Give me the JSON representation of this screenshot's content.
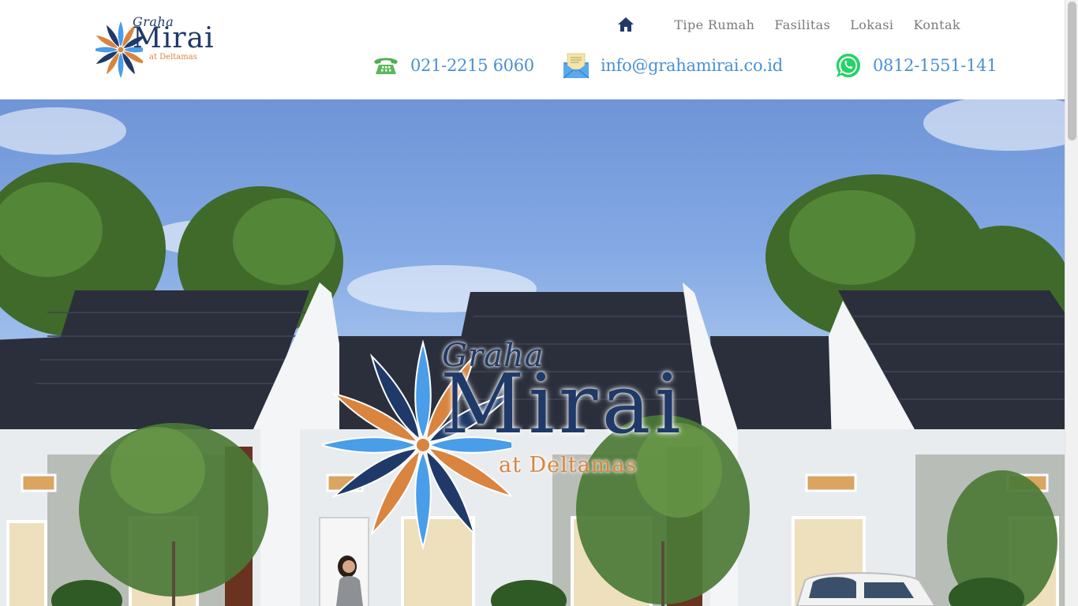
{
  "brand": {
    "graha": "Graha",
    "mirai": "Mirai",
    "deltamas": "at Deltamas",
    "colors": {
      "navy": "#1f3a68",
      "orange": "#d9843f",
      "blue": "#4a9de8"
    }
  },
  "nav": {
    "home_icon": "home-icon",
    "items": [
      {
        "label": "Tipe Rumah"
      },
      {
        "label": "Fasilitas"
      },
      {
        "label": "Lokasi"
      },
      {
        "label": "Kontak"
      }
    ]
  },
  "contact": {
    "phone": {
      "icon": "telephone-icon",
      "text": "021-2215 6060"
    },
    "email": {
      "icon": "envelope-icon",
      "text": "info@grahamirai.co.id"
    },
    "whatsapp": {
      "icon": "whatsapp-icon",
      "text": "0812-1551-141"
    },
    "text_color": "#4a90d6"
  },
  "hero": {
    "logo": {
      "graha": "Graha",
      "mirai": "Mirai",
      "deltamas": "at Deltamas"
    }
  }
}
